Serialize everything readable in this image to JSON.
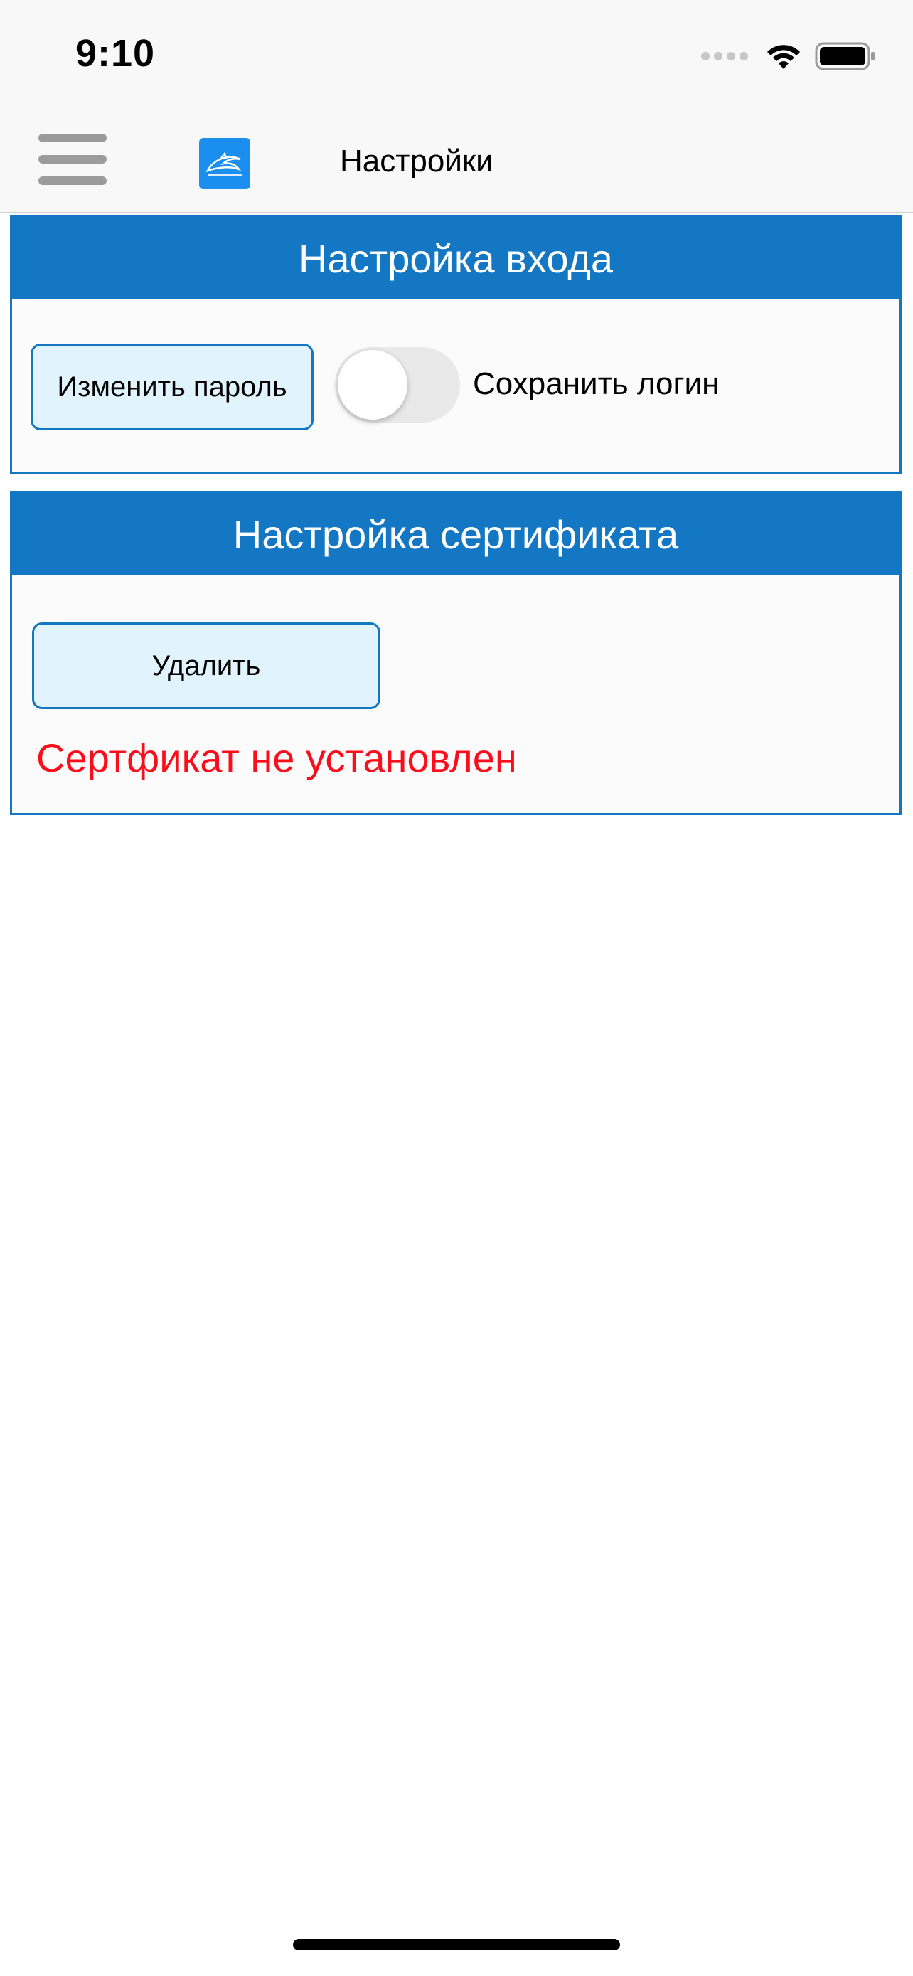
{
  "status_bar": {
    "time": "9:10",
    "icons": [
      "signal-icon",
      "wifi-icon",
      "battery-icon"
    ]
  },
  "nav": {
    "title": "Настройки",
    "menu_icon": "hamburger-menu-icon",
    "logo_icon": "dolphin-logo-icon"
  },
  "login_settings": {
    "header": "Настройка входа",
    "change_password_label": "Изменить пароль",
    "save_login_label": "Сохранить логин",
    "save_login_enabled": false
  },
  "certificate_settings": {
    "header": "Настройка сертификата",
    "delete_label": "Удалить",
    "status_text": "Сертфикат не установлен"
  },
  "colors": {
    "accent": "#1377c3",
    "button_bg": "#e1f3fd",
    "error_text": "#fc0d1b",
    "toggle_off": "#e9e9ea"
  }
}
